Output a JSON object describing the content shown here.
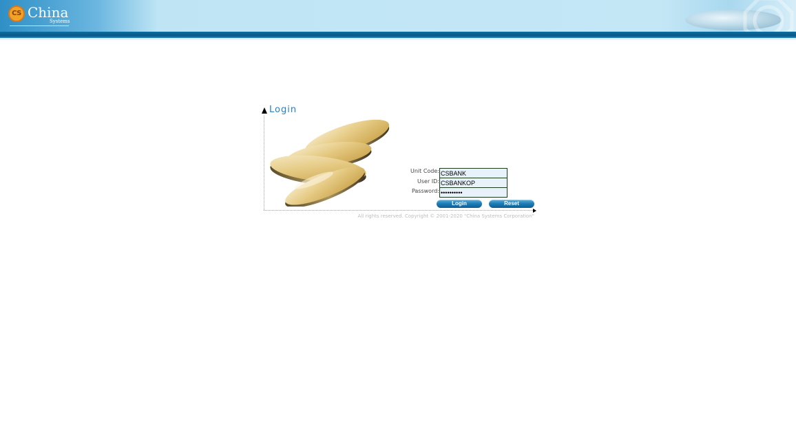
{
  "header": {
    "logo_badge": "CS",
    "logo_name": "China",
    "logo_sub": "Systems",
    "brand_color": "#2f8fc6",
    "bar_color": "#0a5885"
  },
  "login": {
    "title": "Login",
    "fields": {
      "unit_code": {
        "label": "Unit Code:",
        "value": "CSBANK"
      },
      "user_id": {
        "label": "User ID:",
        "value": "CSBANKOP"
      },
      "password": {
        "label": "Password:",
        "value": "cspassword"
      }
    },
    "login_button": "Login",
    "reset_button": "Reset",
    "title_color": "#2581c4"
  },
  "footer": {
    "copyright": "All rights reserved. Copyright © 2001-2020 \"China Systems Corporation\""
  }
}
